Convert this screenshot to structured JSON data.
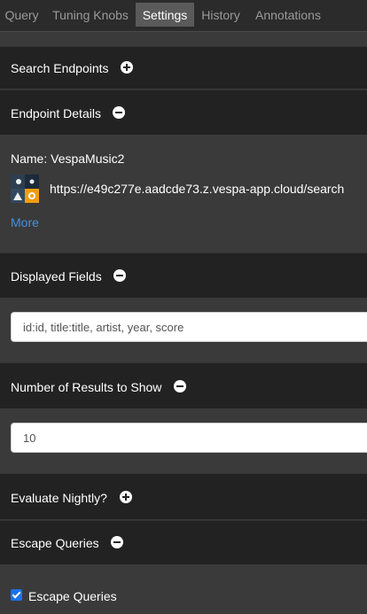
{
  "tabs": [
    {
      "label": "Query"
    },
    {
      "label": "Tuning Knobs"
    },
    {
      "label": "Settings"
    },
    {
      "label": "History"
    },
    {
      "label": "Annotations"
    }
  ],
  "active_tab": "Settings",
  "sections": {
    "search_endpoints": {
      "title": "Search Endpoints",
      "toggle": "expand"
    },
    "endpoint_details": {
      "title": "Endpoint Details",
      "toggle": "collapse",
      "name_label": "Name: VespaMusic2",
      "url": "https://e49c277e.aadcde73.z.vespa-app.cloud/search",
      "more_link": "More"
    },
    "displayed_fields": {
      "title": "Displayed Fields",
      "toggle": "collapse",
      "value": "id:id, title:title, artist, year, score"
    },
    "num_results": {
      "title": "Number of Results to Show",
      "toggle": "collapse",
      "value": "10"
    },
    "evaluate_nightly": {
      "title": "Evaluate Nightly?",
      "toggle": "expand"
    },
    "escape_queries": {
      "title": "Escape Queries",
      "toggle": "collapse",
      "checkbox_label": "Escape Queries",
      "checked": true
    }
  },
  "colors": {
    "background": "#3a3a3a",
    "header_bg": "#222222",
    "active_tab_bg": "#5a5a5a",
    "link": "#4a90d9",
    "checkbox": "#1a73e8"
  }
}
